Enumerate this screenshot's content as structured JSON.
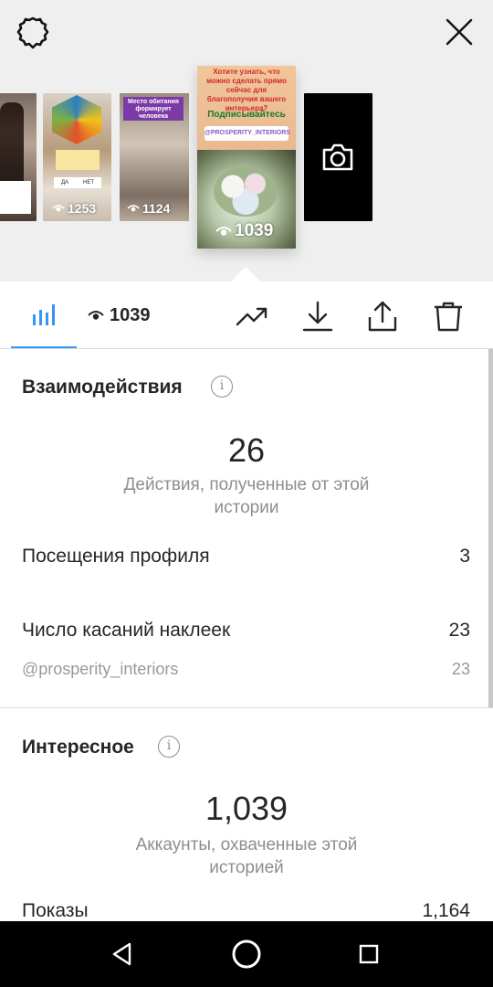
{
  "story_strip": {
    "thumbnails": [
      {
        "id": "story-1",
        "views": ""
      },
      {
        "id": "story-2",
        "views": "1253",
        "yes": "ДА",
        "no": "НЕТ"
      },
      {
        "id": "story-3",
        "views": "1124",
        "header": "Место обитания формирует человека"
      },
      {
        "id": "story-4",
        "views": "1039",
        "question": "Хотите узнать, что можно сделать прямо сейчас для благополучия вашего интерьера?",
        "subscribe": "Подписывайтесь",
        "mention": "@PROSPERITY_INTERIORS",
        "selected": true
      },
      {
        "id": "story-camera",
        "icon": "camera-icon"
      }
    ]
  },
  "toolbar": {
    "view_count": "1039",
    "icons": [
      "bar-chart-icon",
      "eye-icon",
      "trending-up-icon",
      "download-icon",
      "share-icon",
      "trash-icon"
    ],
    "accent": "#3897f0"
  },
  "interactions": {
    "title": "Взаимодействия",
    "total": "26",
    "caption": "Действия, полученные от этой истории",
    "rows": [
      {
        "label": "Посещения профиля",
        "value": "3"
      },
      {
        "label": "Число касаний наклеек",
        "value": "23"
      }
    ],
    "sub_row": {
      "label": "@prosperity_interiors",
      "value": "23"
    }
  },
  "discovery": {
    "title": "Интересное",
    "total": "1,039",
    "caption": "Аккаунты, охваченные этой историей",
    "rows": [
      {
        "label": "Показы",
        "value": "1,164"
      }
    ]
  }
}
